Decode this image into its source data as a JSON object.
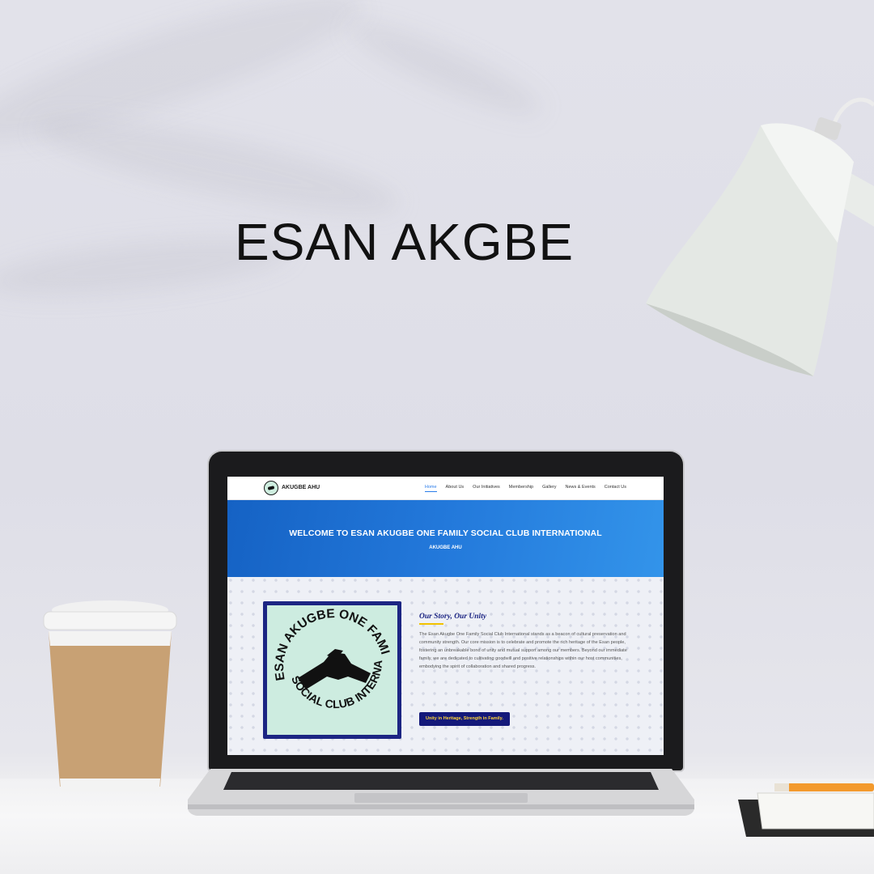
{
  "headline": "ESAN AKGBE",
  "site": {
    "brand": "AKUGBE AHU",
    "nav": [
      {
        "label": "Home",
        "active": true
      },
      {
        "label": "About Us",
        "active": false
      },
      {
        "label": "Our Initiatives",
        "active": false
      },
      {
        "label": "Membership",
        "active": false
      },
      {
        "label": "Gallery",
        "active": false
      },
      {
        "label": "News & Events",
        "active": false
      },
      {
        "label": "Contact Us",
        "active": false
      }
    ],
    "hero": {
      "title": "WELCOME TO ESAN AKUGBE ONE FAMILY SOCIAL CLUB INTERNATIONAL",
      "subtitle": "AKUGBE AHU"
    },
    "emblem": {
      "top_text": "ESAN AKUGBE ONE FAMILY",
      "bottom_text": "SOCIAL CLUB INTERNATIONAL"
    },
    "story": {
      "title": "Our Story, Our Unity",
      "body": "The Esan Akugbe One Family Social Club International stands as a beacon of cultural preservation and community strength. Our core mission is to celebrate and promote the rich heritage of the Esan people, fostering an unbreakable bond of unity and mutual support among our members. Beyond our immediate family, we are dedicated to cultivating goodwill and positive relationships within our host communities, embodying the spirit of collaboration and shared progress.",
      "motto": "Unity in Heritage, Strength in Family."
    }
  },
  "colors": {
    "hero_start": "#1562c4",
    "hero_end": "#3394ea",
    "accent_navy": "#1c2583",
    "accent_gold": "#f2c200",
    "nav_active": "#2b7de9",
    "emblem_bg": "#cdece0"
  }
}
